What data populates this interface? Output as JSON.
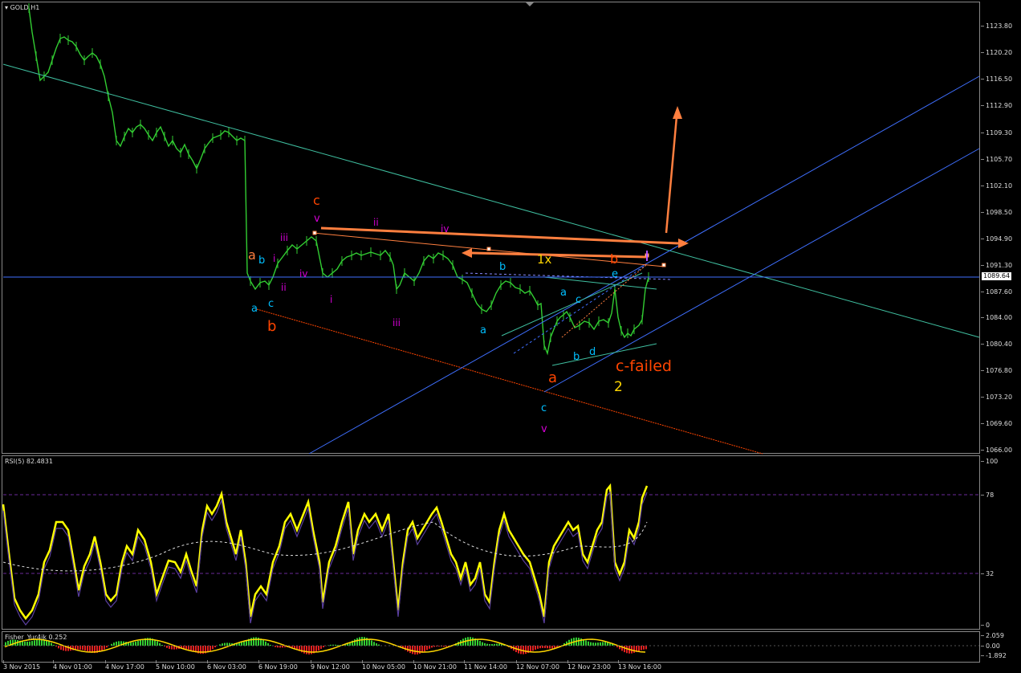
{
  "window": {
    "symbol_title": "GOLD,H1"
  },
  "price_axis": [
    "1123.80",
    "1120.20",
    "1116.50",
    "1112.90",
    "1109.30",
    "1105.70",
    "1102.10",
    "1098.50",
    "1094.90",
    "1091.30",
    "1087.60",
    "1084.00",
    "1080.40",
    "1076.80",
    "1073.20",
    "1069.60",
    "1066.00"
  ],
  "current_price": "1089.64",
  "rsi": {
    "title": "RSI(5) 82.4831",
    "axis": [
      "100",
      "78",
      "32",
      "0"
    ],
    "levels": [
      78,
      32
    ]
  },
  "fisher": {
    "title": "Fisher_Yur4ik 0.252",
    "axis": [
      "2.059",
      "0.00",
      "-1.892"
    ]
  },
  "time_axis": [
    "3 Nov 2015",
    "4 Nov 01:00",
    "4 Nov 17:00",
    "5 Nov 10:00",
    "6 Nov 03:00",
    "6 Nov 19:00",
    "9 Nov 12:00",
    "10 Nov 05:00",
    "10 Nov 21:00",
    "11 Nov 14:00",
    "12 Nov 07:00",
    "12 Nov 23:00",
    "13 Nov 16:00"
  ],
  "colors": {
    "bull": "#32cd32",
    "orange": "#ff7f3f",
    "red": "#ff4500",
    "cyan": "#00bfff",
    "magenta": "#d400d4",
    "gold": "#ffd700",
    "rsi": "#ffff00",
    "blue_line": "#3f6fff",
    "teal_line": "#3fbfa0"
  },
  "wave_labels": [
    {
      "id": "c-major",
      "text": "c",
      "color": "#ff4500"
    },
    {
      "id": "v-major",
      "text": "v",
      "color": "#d400d4"
    },
    {
      "id": "ii-top",
      "text": "ii",
      "color": "#d400d4"
    },
    {
      "id": "iv-top",
      "text": "iv",
      "color": "#d400d4"
    },
    {
      "id": "iii-left",
      "text": "iii",
      "color": "#d400d4"
    },
    {
      "id": "a-orange",
      "text": "a",
      "color": "#ff7f3f"
    },
    {
      "id": "b-cyan-left",
      "text": "b",
      "color": "#00bfff"
    },
    {
      "id": "i-left",
      "text": "i",
      "color": "#d400d4"
    },
    {
      "id": "iv-left",
      "text": "iv",
      "color": "#d400d4"
    },
    {
      "id": "ii-left",
      "text": "ii",
      "color": "#d400d4"
    },
    {
      "id": "a-cyan-left",
      "text": "a",
      "color": "#00bfff"
    },
    {
      "id": "c-cyan-left",
      "text": "c",
      "color": "#00bfff"
    },
    {
      "id": "b-orange-left",
      "text": "b",
      "color": "#ff4500"
    },
    {
      "id": "i-mid",
      "text": "i",
      "color": "#d400d4"
    },
    {
      "id": "iii-mid",
      "text": "iii",
      "color": "#d400d4"
    },
    {
      "id": "b-cyan-mid",
      "text": "b",
      "color": "#00bfff"
    },
    {
      "id": "a-cyan-mid",
      "text": "a",
      "color": "#00bfff"
    },
    {
      "id": "1x",
      "text": "1x",
      "color": "#ffd700"
    },
    {
      "id": "b-orange-right",
      "text": "b",
      "color": "#ff4500"
    },
    {
      "id": "a-cyan-right",
      "text": "a",
      "color": "#00bfff"
    },
    {
      "id": "c-cyan-right",
      "text": "c",
      "color": "#00bfff"
    },
    {
      "id": "e-cyan",
      "text": "e",
      "color": "#00bfff"
    },
    {
      "id": "b-cyan-right",
      "text": "b",
      "color": "#00bfff"
    },
    {
      "id": "d-cyan",
      "text": "d",
      "color": "#00bfff"
    },
    {
      "id": "a-orange-bottom",
      "text": "a",
      "color": "#ff4500"
    },
    {
      "id": "c-failed",
      "text": "c-failed",
      "color": "#ff4500"
    },
    {
      "id": "two",
      "text": "2",
      "color": "#ffd700"
    },
    {
      "id": "c-cyan-bottom",
      "text": "c",
      "color": "#00bfff"
    },
    {
      "id": "v-bottom",
      "text": "v",
      "color": "#d400d4"
    }
  ]
}
